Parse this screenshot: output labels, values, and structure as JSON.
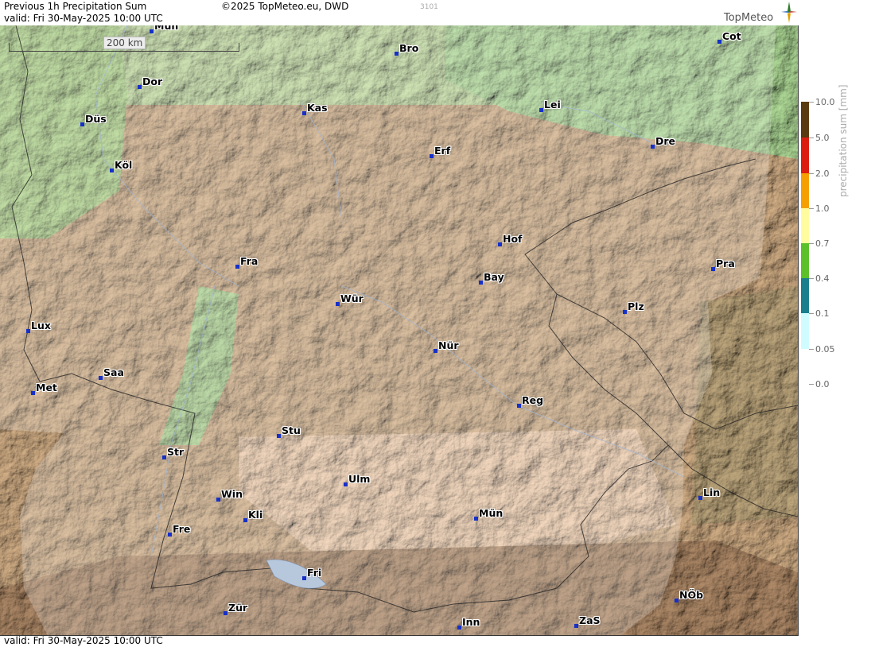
{
  "header": {
    "title": "Previous 1h Precipitation Sum",
    "valid": "valid:  Fri  30-May-2025 10:00 UTC",
    "copyright": "©2025 TopMeteo.eu, DWD",
    "code": "3101",
    "brand": "TopMeteo"
  },
  "footer": {
    "valid": "valid:  Fri  30-May-2025 10:00 UTC"
  },
  "scale": {
    "label": "200 km"
  },
  "legend": {
    "title": "precipitation sum [mm]",
    "entries": [
      {
        "label": "10.0",
        "color": "#5a3a10"
      },
      {
        "label": "5.0",
        "color": "#dc1e10"
      },
      {
        "label": "2.0",
        "color": "#f5a000"
      },
      {
        "label": "1.0",
        "color": "#fffca0"
      },
      {
        "label": "0.7",
        "color": "#5cc02a"
      },
      {
        "label": "0.4",
        "color": "#1a7e8c"
      },
      {
        "label": "0.1",
        "color": "#d0fcff"
      },
      {
        "label": "0.05",
        "color": "#ffffff"
      },
      {
        "label": "0.0",
        "color": "#ffffff"
      }
    ]
  },
  "cities": [
    {
      "name": "Mün",
      "id": "mun-top"
    },
    {
      "name": "Bro",
      "id": "bro"
    },
    {
      "name": "Cot",
      "id": "cot"
    },
    {
      "name": "Dor",
      "id": "dor"
    },
    {
      "name": "Kas",
      "id": "kas"
    },
    {
      "name": "Lei",
      "id": "lei"
    },
    {
      "name": "Düs",
      "id": "dus"
    },
    {
      "name": "Dre",
      "id": "dre"
    },
    {
      "name": "Erf",
      "id": "erf"
    },
    {
      "name": "Köl",
      "id": "kol"
    },
    {
      "name": "Hof",
      "id": "hof"
    },
    {
      "name": "Fra",
      "id": "fra"
    },
    {
      "name": "Pra",
      "id": "pra"
    },
    {
      "name": "Bay",
      "id": "bay"
    },
    {
      "name": "Wür",
      "id": "wur"
    },
    {
      "name": "Plz",
      "id": "plz"
    },
    {
      "name": "Lux",
      "id": "lux"
    },
    {
      "name": "Nür",
      "id": "nur"
    },
    {
      "name": "Saa",
      "id": "saa"
    },
    {
      "name": "Met",
      "id": "met"
    },
    {
      "name": "Reg",
      "id": "reg"
    },
    {
      "name": "Stu",
      "id": "stu"
    },
    {
      "name": "Str",
      "id": "str"
    },
    {
      "name": "Ulm",
      "id": "ulm"
    },
    {
      "name": "Lin",
      "id": "lin"
    },
    {
      "name": "Win",
      "id": "win"
    },
    {
      "name": "Kli",
      "id": "kli"
    },
    {
      "name": "Mün",
      "id": "mun"
    },
    {
      "name": "Fre",
      "id": "fre"
    },
    {
      "name": "Fri",
      "id": "fri"
    },
    {
      "name": "NÖb",
      "id": "nob"
    },
    {
      "name": "Zür",
      "id": "zur"
    },
    {
      "name": "Inn",
      "id": "inn"
    },
    {
      "name": "ZaS",
      "id": "zas"
    }
  ]
}
